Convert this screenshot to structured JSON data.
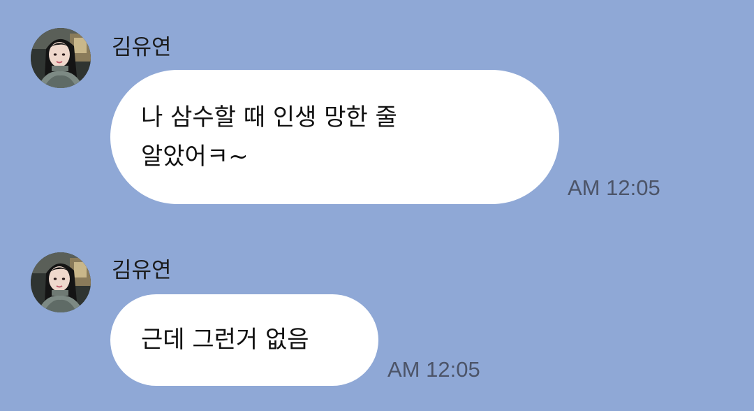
{
  "chat": {
    "background_color": "#8fa8d6",
    "messages": [
      {
        "sender": "김유연",
        "avatar": "profile-photo",
        "lines": [
          "나 삼수할 때 인생 망한 줄",
          "알았어ㅋ~"
        ],
        "time": "AM 12:05"
      },
      {
        "sender": "김유연",
        "avatar": "profile-photo",
        "lines": [
          "근데 그런거 없음"
        ],
        "time": "AM 12:05"
      }
    ]
  }
}
